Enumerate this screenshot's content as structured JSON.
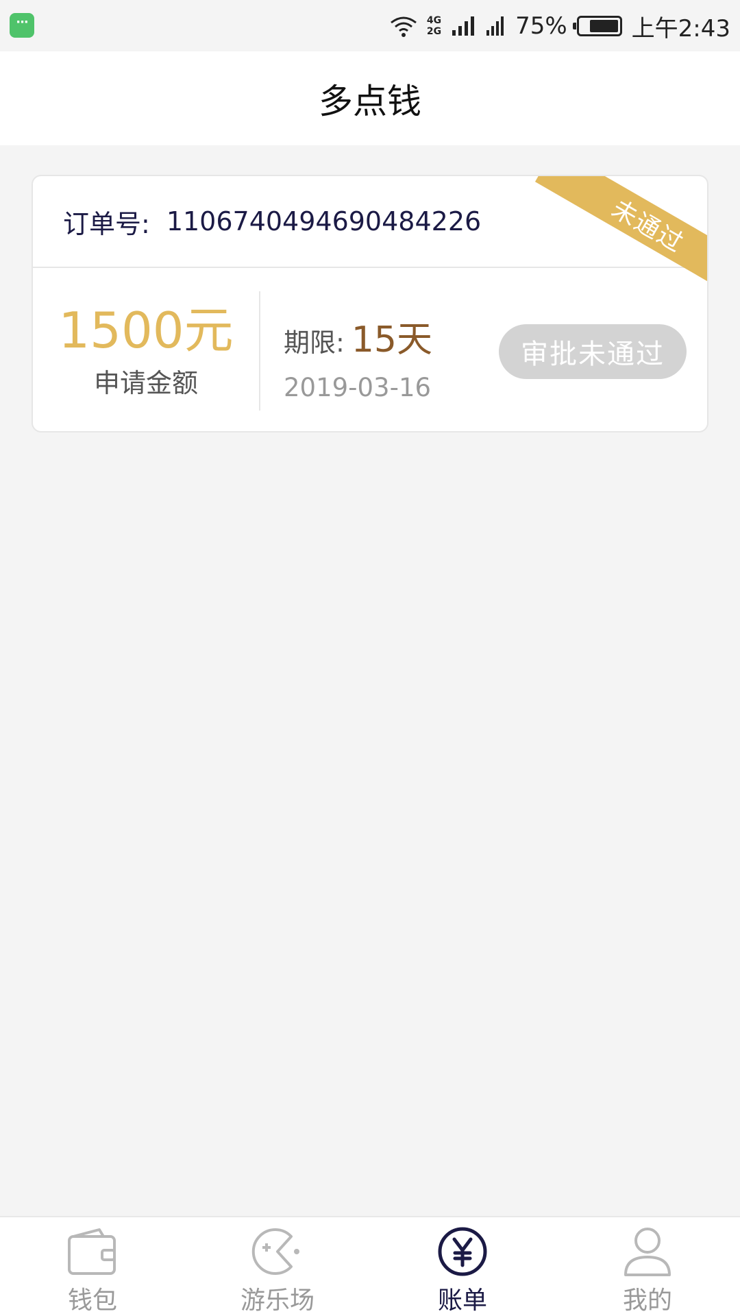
{
  "status_bar": {
    "net_type_top": "4G",
    "net_type_bottom": "2G",
    "battery_percent": "75%",
    "battery_level": 0.75,
    "time": "上午2:43",
    "icons": [
      "chat-app-icon",
      "wifi-icon",
      "signal-icon",
      "signal-icon",
      "battery-icon"
    ]
  },
  "header": {
    "title": "多点钱"
  },
  "order": {
    "order_label": "订单号:",
    "order_number": "1106740494690484226",
    "ribbon_text": "未通过",
    "amount": "1500元",
    "amount_label": "申请金额",
    "term_label": "期限:",
    "term_value": "15天",
    "date": "2019-03-16",
    "status_button": "审批未通过"
  },
  "colors": {
    "accent_gold": "#e2b95c",
    "term_brown": "#8a5a2a",
    "navy": "#1b1a45",
    "disabled_gray": "#d3d3d3"
  },
  "tabs": [
    {
      "label": "钱包",
      "icon": "wallet-icon",
      "active": false
    },
    {
      "label": "游乐场",
      "icon": "game-icon",
      "active": false
    },
    {
      "label": "账单",
      "icon": "yuan-icon",
      "active": true
    },
    {
      "label": "我的",
      "icon": "user-icon",
      "active": false
    }
  ]
}
